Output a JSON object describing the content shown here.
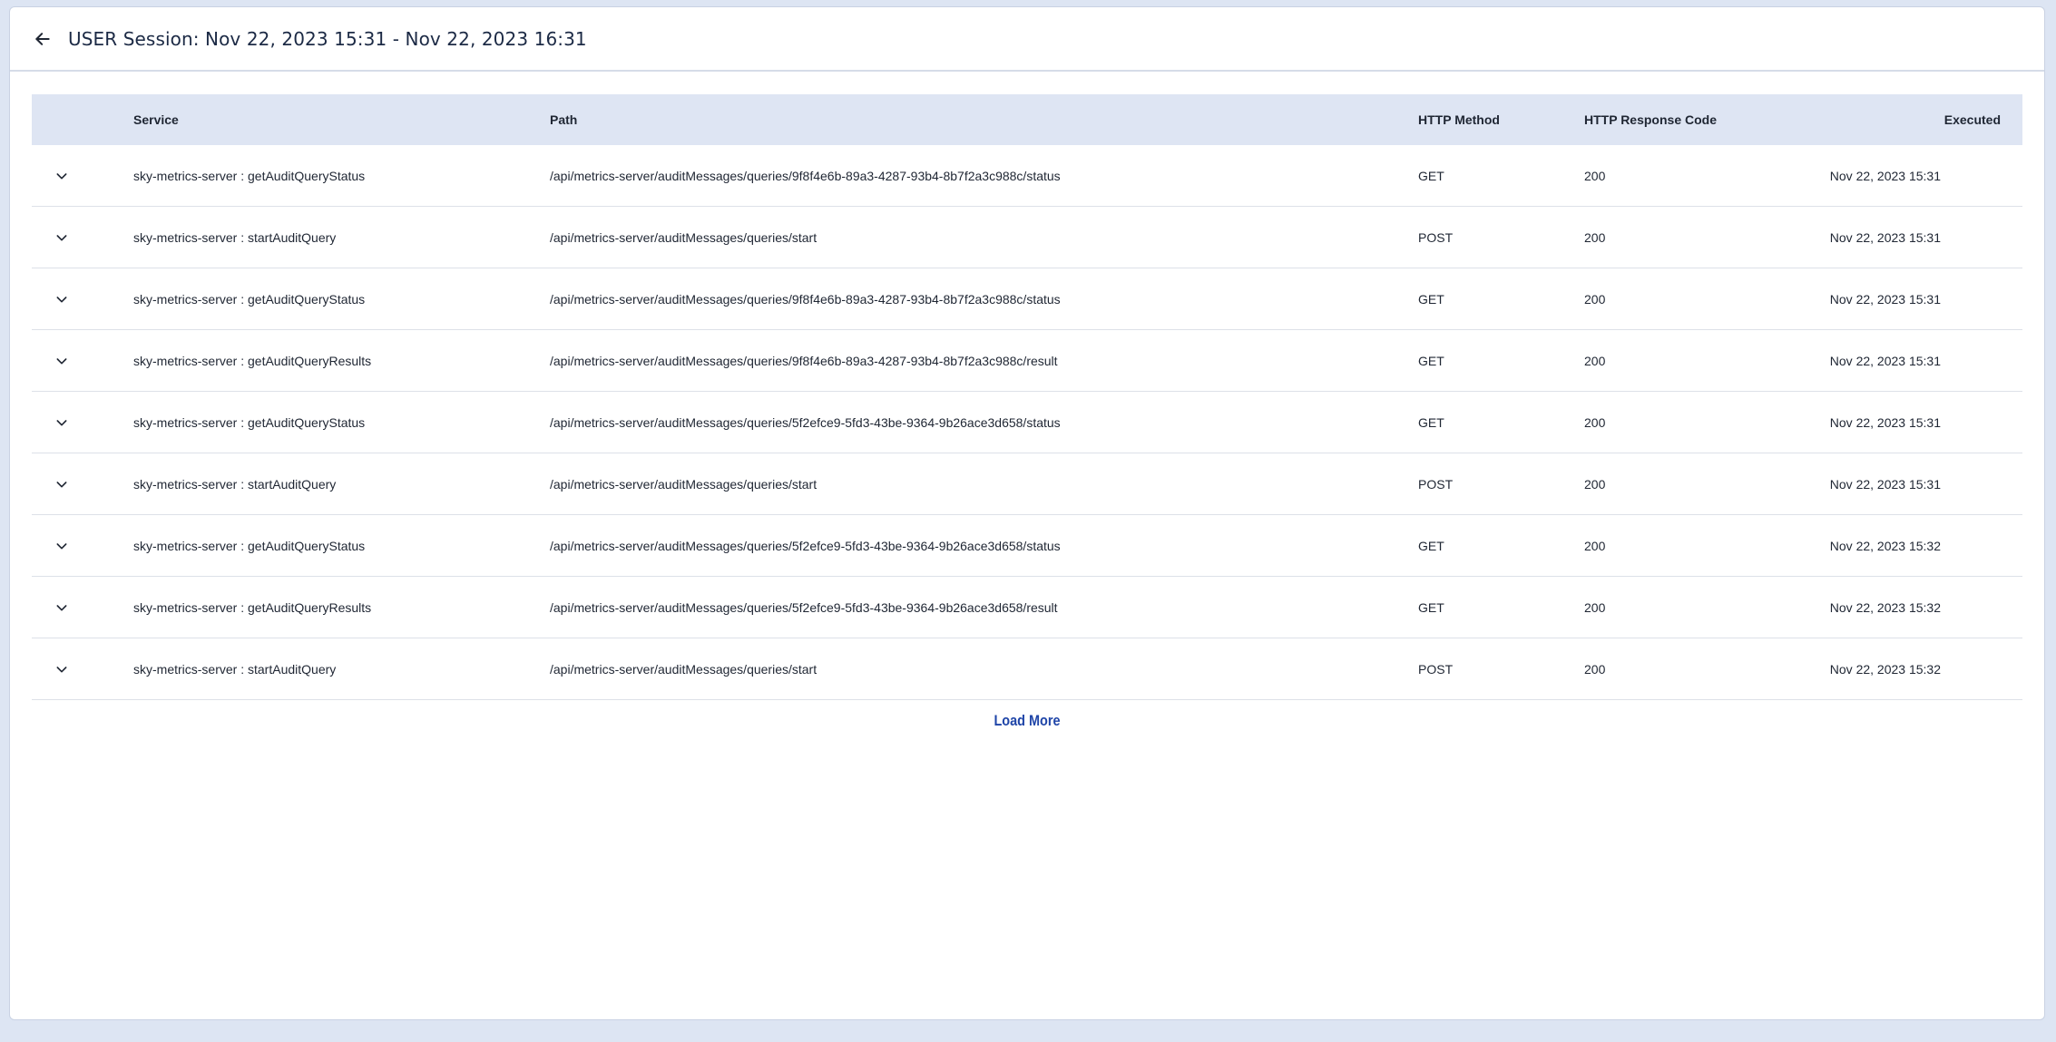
{
  "header": {
    "title": "USER Session: Nov 22, 2023 15:31 - Nov 22, 2023 16:31",
    "back_icon": "arrow-left-icon"
  },
  "table": {
    "columns": {
      "service": "Service",
      "path": "Path",
      "method": "HTTP Method",
      "code": "HTTP Response Code",
      "executed": "Executed"
    },
    "rows": [
      {
        "service": "sky-metrics-server : getAuditQueryStatus",
        "path": "/api/metrics-server/auditMessages/queries/9f8f4e6b-89a3-4287-93b4-8b7f2a3c988c/status",
        "method": "GET",
        "code": "200",
        "executed": "Nov 22, 2023 15:31"
      },
      {
        "service": "sky-metrics-server : startAuditQuery",
        "path": "/api/metrics-server/auditMessages/queries/start",
        "method": "POST",
        "code": "200",
        "executed": "Nov 22, 2023 15:31"
      },
      {
        "service": "sky-metrics-server : getAuditQueryStatus",
        "path": "/api/metrics-server/auditMessages/queries/9f8f4e6b-89a3-4287-93b4-8b7f2a3c988c/status",
        "method": "GET",
        "code": "200",
        "executed": "Nov 22, 2023 15:31"
      },
      {
        "service": "sky-metrics-server : getAuditQueryResults",
        "path": "/api/metrics-server/auditMessages/queries/9f8f4e6b-89a3-4287-93b4-8b7f2a3c988c/result",
        "method": "GET",
        "code": "200",
        "executed": "Nov 22, 2023 15:31"
      },
      {
        "service": "sky-metrics-server : getAuditQueryStatus",
        "path": "/api/metrics-server/auditMessages/queries/5f2efce9-5fd3-43be-9364-9b26ace3d658/status",
        "method": "GET",
        "code": "200",
        "executed": "Nov 22, 2023 15:31"
      },
      {
        "service": "sky-metrics-server : startAuditQuery",
        "path": "/api/metrics-server/auditMessages/queries/start",
        "method": "POST",
        "code": "200",
        "executed": "Nov 22, 2023 15:31"
      },
      {
        "service": "sky-metrics-server : getAuditQueryStatus",
        "path": "/api/metrics-server/auditMessages/queries/5f2efce9-5fd3-43be-9364-9b26ace3d658/status",
        "method": "GET",
        "code": "200",
        "executed": "Nov 22, 2023 15:32"
      },
      {
        "service": "sky-metrics-server : getAuditQueryResults",
        "path": "/api/metrics-server/auditMessages/queries/5f2efce9-5fd3-43be-9364-9b26ace3d658/result",
        "method": "GET",
        "code": "200",
        "executed": "Nov 22, 2023 15:32"
      },
      {
        "service": "sky-metrics-server : startAuditQuery",
        "path": "/api/metrics-server/auditMessages/queries/start",
        "method": "POST",
        "code": "200",
        "executed": "Nov 22, 2023 15:32"
      }
    ],
    "expand_icon": "chevron-down-icon"
  },
  "footer": {
    "load_more_label": "Load More"
  },
  "colors": {
    "background": "#dde5f3",
    "header_row": "#dee5f3",
    "accent": "#1f45a8"
  }
}
